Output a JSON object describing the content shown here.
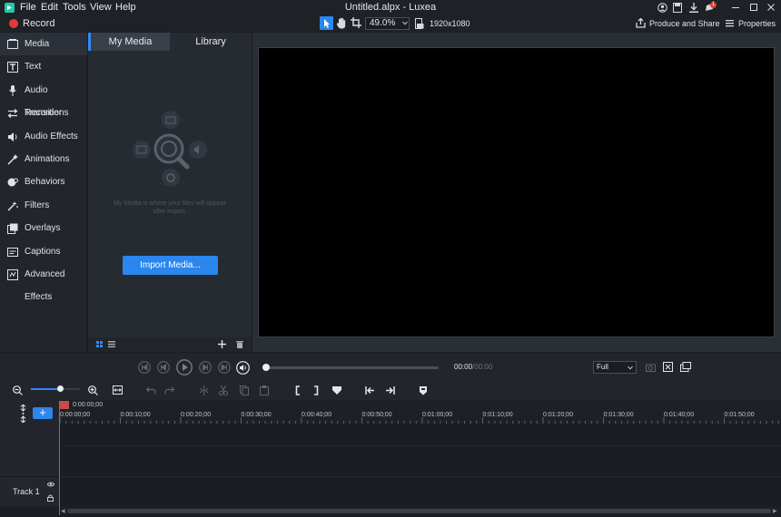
{
  "app": {
    "title": "Untitled.alpx - Luxea",
    "menu": [
      "File",
      "Edit",
      "Tools",
      "View",
      "Help"
    ],
    "notification_count": "1"
  },
  "toolbar": {
    "record_label": "Record",
    "zoom_value": "49.0%",
    "resolution": "1920x1080",
    "produce_label": "Produce and Share",
    "properties_label": "Properties"
  },
  "sidebar": {
    "items": [
      {
        "label": "Media",
        "icon": "media-icon"
      },
      {
        "label": "Text",
        "icon": "text-icon"
      },
      {
        "label": "Audio Recorder",
        "icon": "microphone-icon"
      },
      {
        "label": "Transitions",
        "icon": "transitions-icon"
      },
      {
        "label": "Audio Effects",
        "icon": "speaker-icon"
      },
      {
        "label": "Animations",
        "icon": "animation-icon"
      },
      {
        "label": "Behaviors",
        "icon": "behaviors-icon"
      },
      {
        "label": "Filters",
        "icon": "filters-icon"
      },
      {
        "label": "Overlays",
        "icon": "overlays-icon"
      },
      {
        "label": "Captions",
        "icon": "captions-icon"
      },
      {
        "label": "Advanced Effects",
        "icon": "advanced-effects-icon"
      }
    ]
  },
  "media": {
    "tabs": [
      "My Media",
      "Library"
    ],
    "empty_text": "My Media is where your files will appear after import.",
    "import_button": "Import Media..."
  },
  "transport": {
    "timecode": "00:00",
    "duration": "00:00",
    "quality": "Full"
  },
  "timeline": {
    "playhead_time": "0:00:00;00",
    "ruler_labels": [
      "0:00:00;00",
      "0:00:10;00",
      "0:00:20;00",
      "0:00:30;00",
      "0:00:40;00",
      "0:00:50;00",
      "0:01:00;00",
      "0:01:10;00",
      "0:01:20;00",
      "0:01:30;00",
      "0:01:40;00",
      "0:01:50;00"
    ],
    "track_name": "Track 1"
  },
  "colors": {
    "accent": "#2b86ee",
    "record": "#e53935",
    "background": "#1b1e23"
  }
}
